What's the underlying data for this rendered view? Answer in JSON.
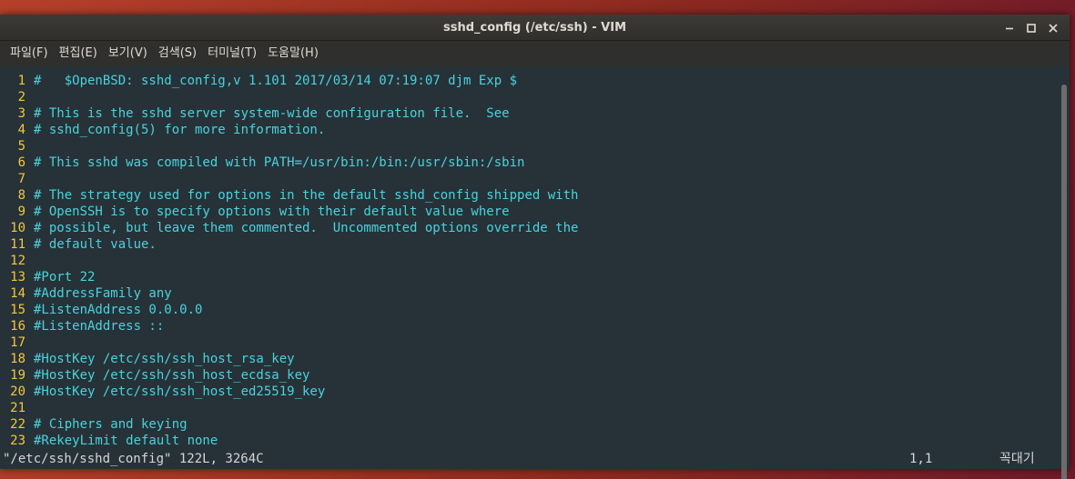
{
  "window": {
    "title": "sshd_config (/etc/ssh) - VIM"
  },
  "menu": [
    {
      "label": "파일(F)"
    },
    {
      "label": "편집(E)"
    },
    {
      "label": "보기(V)"
    },
    {
      "label": "검색(S)"
    },
    {
      "label": "터미널(T)"
    },
    {
      "label": "도움말(H)"
    }
  ],
  "editor": {
    "lines": [
      {
        "num": "1",
        "text": "#\t$OpenBSD: sshd_config,v 1.101 2017/03/14 07:19:07 djm Exp $"
      },
      {
        "num": "2",
        "text": ""
      },
      {
        "num": "3",
        "text": "# This is the sshd server system-wide configuration file.  See"
      },
      {
        "num": "4",
        "text": "# sshd_config(5) for more information."
      },
      {
        "num": "5",
        "text": ""
      },
      {
        "num": "6",
        "text": "# This sshd was compiled with PATH=/usr/bin:/bin:/usr/sbin:/sbin"
      },
      {
        "num": "7",
        "text": ""
      },
      {
        "num": "8",
        "text": "# The strategy used for options in the default sshd_config shipped with"
      },
      {
        "num": "9",
        "text": "# OpenSSH is to specify options with their default value where"
      },
      {
        "num": "10",
        "text": "# possible, but leave them commented.  Uncommented options override the"
      },
      {
        "num": "11",
        "text": "# default value."
      },
      {
        "num": "12",
        "text": ""
      },
      {
        "num": "13",
        "text": "#Port 22"
      },
      {
        "num": "14",
        "text": "#AddressFamily any"
      },
      {
        "num": "15",
        "text": "#ListenAddress 0.0.0.0"
      },
      {
        "num": "16",
        "text": "#ListenAddress ::"
      },
      {
        "num": "17",
        "text": ""
      },
      {
        "num": "18",
        "text": "#HostKey /etc/ssh/ssh_host_rsa_key"
      },
      {
        "num": "19",
        "text": "#HostKey /etc/ssh/ssh_host_ecdsa_key"
      },
      {
        "num": "20",
        "text": "#HostKey /etc/ssh/ssh_host_ed25519_key"
      },
      {
        "num": "21",
        "text": ""
      },
      {
        "num": "22",
        "text": "# Ciphers and keying"
      },
      {
        "num": "23",
        "text": "#RekeyLimit default none"
      }
    ]
  },
  "status": {
    "file_info": "\"/etc/ssh/sshd_config\" 122L, 3264C",
    "cursor_pos": "1,1",
    "ime_mode": "꼭대기"
  },
  "colors": {
    "background": "#263238",
    "comment_text": "#4ad2dc",
    "line_number": "#f4c63d",
    "titlebar": "#3c3b37"
  },
  "icons": {
    "minimize": "minimize-icon",
    "maximize": "maximize-icon",
    "close": "close-icon"
  }
}
